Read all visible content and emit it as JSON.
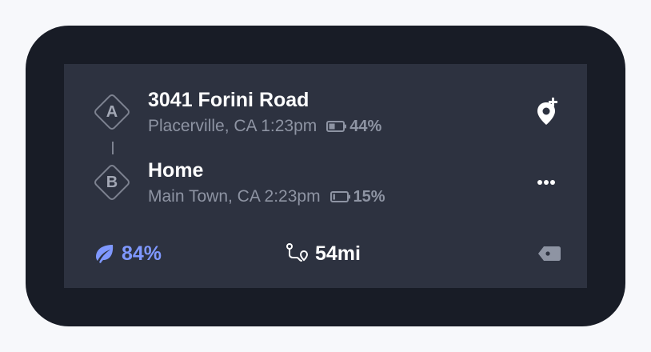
{
  "route": {
    "origin": {
      "marker": "A",
      "title": "3041 Forini Road",
      "subtitle": "Placerville, CA 1:23pm",
      "battery": "44%",
      "battery_level": 0.44
    },
    "destination": {
      "marker": "B",
      "title": "Home",
      "subtitle": "Main Town, CA 2:23pm",
      "battery": "15%",
      "battery_level": 0.15
    }
  },
  "footer": {
    "efficiency": "84%",
    "distance": "54mi"
  },
  "icons": {
    "add_stop": "map-pin-plus-icon",
    "more": "more-horizontal-icon",
    "eco": "leaf-icon",
    "route": "route-icon",
    "tag": "tag-icon"
  },
  "colors": {
    "bezel": "#181c26",
    "screen": "#2d3240",
    "accent": "#7f98ff",
    "muted_text": "#8e94a3",
    "primary_text": "#ffffff"
  }
}
